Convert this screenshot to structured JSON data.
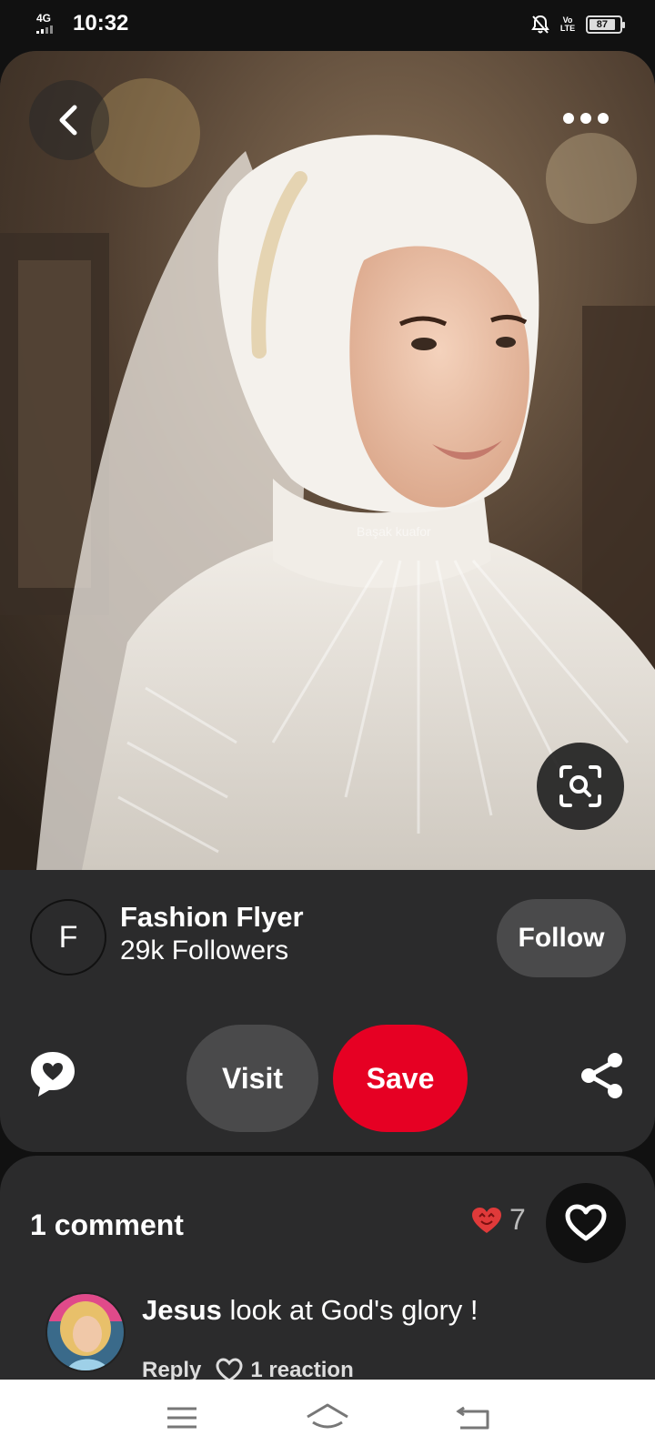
{
  "status_bar": {
    "network": "4G",
    "time": "10:32",
    "volte": "Vo LTE",
    "battery": "87",
    "battery_level": 0.87
  },
  "pin": {
    "image_desc_icon": "bride-photo",
    "watermark": "Başak kuafor",
    "back_icon": "chevron-left-icon",
    "more_icon": "more-horizontal-icon",
    "lens_icon": "visual-search-icon"
  },
  "creator": {
    "initial": "F",
    "name": "Fashion Flyer",
    "followers": "29k Followers",
    "follow_label": "Follow"
  },
  "actions": {
    "visit_label": "Visit",
    "save_label": "Save",
    "comment_icon": "comment-heart-icon",
    "share_icon": "share-icon"
  },
  "comments": {
    "count_label": "1 comment",
    "reaction_count": "7",
    "items": [
      {
        "author": "Jesus",
        "text": "look at God's glory !",
        "reply_label": "Reply",
        "reaction_label": "1 reaction"
      }
    ]
  },
  "colors": {
    "save": "#e60023",
    "card": "#2b2b2c",
    "pill": "#4a4a4b"
  }
}
